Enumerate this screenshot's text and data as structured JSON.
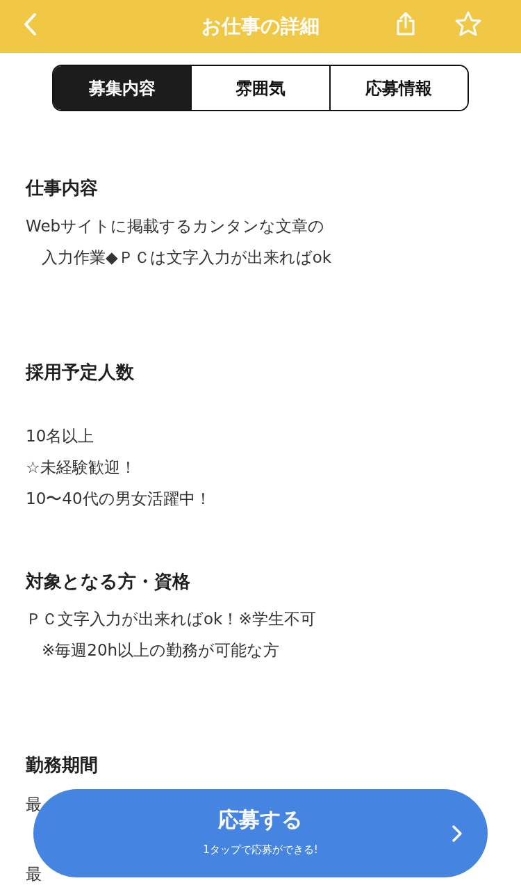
{
  "header": {
    "title": "お仕事の詳細"
  },
  "tabs": [
    {
      "label": "募集内容",
      "selected": true
    },
    {
      "label": "雰囲気",
      "selected": false
    },
    {
      "label": "応募情報",
      "selected": false
    }
  ],
  "sections": [
    {
      "heading": "仕事内容",
      "lines": [
        "Webサイトに掲載するカンタンな文章の",
        "　入力作業◆ＰＣは文字入力が出来ればok"
      ]
    },
    {
      "heading": "採用予定人数",
      "lines": [
        "10名以上",
        "☆未経験歓迎！",
        "10〜40代の男女活躍中！"
      ]
    },
    {
      "heading": "対象となる方・資格",
      "lines": [
        "ＰＣ文字入力が出来ればok！※学生不可",
        "　※毎週20h以上の勤務が可能な方"
      ]
    },
    {
      "heading": "勤務期間",
      "rows": [
        {
          "label": "最"
        },
        {
          "label": "最"
        }
      ]
    }
  ],
  "apply_button": {
    "label": "応募する",
    "subtitle": "1タップで応募ができる!"
  }
}
